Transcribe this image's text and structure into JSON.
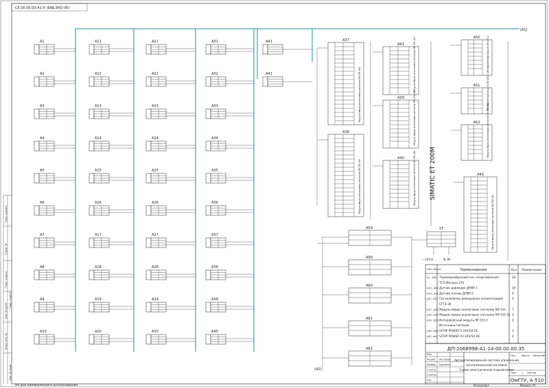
{
  "drawing": {
    "code": "ДП-2068998-А1-14-00.00.00.35",
    "title_lines": [
      "Автоматизированная система управления",
      "вентиляционной системой",
      "Схема электрическая подключения"
    ],
    "org": "ОмГТУ, А-510",
    "rotated_code": "СЕ.00.00.00-А1-У.-ВАБ.8КО-ЯО",
    "corner_refs": [
      "(А1)",
      "(А2)"
    ],
    "format_label": "Формат   А1",
    "copy_label": "Копировал",
    "sheet_labels": [
      "Лит.",
      "Масса",
      "Масштаб",
      "Лист",
      "Листов"
    ],
    "sheet_value": "1",
    "sign_rows": [
      "Изм.",
      "Разраб.",
      "Провер.",
      "Т.контр.",
      "Н.контр.",
      "Утв."
    ],
    "sign_names": [
      "Нестеров",
      "Бурменко"
    ]
  },
  "groups": [
    {
      "prefix": "A",
      "labels": [
        "A1",
        "A2",
        "A3",
        "A4",
        "A5",
        "A6",
        "A7",
        "A8",
        "A9",
        "A10"
      ]
    },
    {
      "prefix": "A1",
      "labels": [
        "A11",
        "A12",
        "A13",
        "A14",
        "A15",
        "A16",
        "A17",
        "A18",
        "A19",
        "A20"
      ]
    },
    {
      "prefix": "A2",
      "labels": [
        "A21",
        "A22",
        "A23",
        "A24",
        "A25",
        "A26",
        "A27",
        "A28",
        "A29",
        "A30"
      ]
    },
    {
      "prefix": "A3",
      "labels": [
        "A31",
        "A32",
        "A33",
        "A34",
        "A35",
        "A36",
        "A37",
        "A38",
        "A39",
        "A40"
      ]
    }
  ],
  "extra_sensors": [
    "A41",
    "A42"
  ],
  "io_modules": [
    {
      "label": "A37",
      "desc": "Модуль ввода аналоговых сигналов SM 331 8AI"
    },
    {
      "label": "A38",
      "desc": "Модуль ввода аналоговых сигналов SM 331 8AI"
    },
    {
      "label": "A41",
      "desc": "Модуль ввода аналоговых сигналов SM 331 8AI"
    },
    {
      "label": "A39",
      "desc": "Модуль ввода аналоговых сигналов SM 331 8AI"
    },
    {
      "label": "A40",
      "desc": "Модуль ввода аналоговых сигналов SM 331 8AI"
    },
    {
      "label": "A50",
      "desc": "Интерфейсный модуль IM 153-2"
    },
    {
      "label": "A51",
      "desc": "Интерфейсный модуль IM 153-2"
    },
    {
      "label": "A52",
      "desc": "Модуль ввода аналоговых сигналов SM 331 8AI"
    },
    {
      "label": "A43",
      "desc": "Модуль ввода аналоговых сигналов SM 331 8AI"
    }
  ],
  "simatic_label": "SIMATIC ET 200M",
  "power_units": [
    "A59",
    "A58",
    "A60",
    "A61",
    "A62"
  ],
  "xt_label": "XT",
  "xt_notes": [
    "~220 В",
    "N, PE"
  ],
  "spec": {
    "headers": [
      "Поз. обозн.",
      "Наименование",
      "Кол.",
      "Примечание"
    ],
    "rows": [
      {
        "pos": "A1...A24",
        "name": "Термопреобразователь сопротивления",
        "qty": "24"
      },
      {
        "pos": "",
        "name": "ТСП Метран-276",
        "qty": ""
      },
      {
        "pos": "A25...A34",
        "name": "Датчик давления ДПВР-1",
        "qty": "10"
      },
      {
        "pos": "A35...A38",
        "name": "Датчик потока ДПВР-2",
        "qty": "4"
      },
      {
        "pos": "A41, A42",
        "name": "Сигнализатор довзрывных концентраций",
        "qty": "2"
      },
      {
        "pos": "",
        "name": "СГГ4-30",
        "qty": ""
      },
      {
        "pos": "A37...A38",
        "name": "Модуль ввода аналоговых сигналов SM 331",
        "qty": "7"
      },
      {
        "pos": "A39...A41",
        "name": "Модуль ввода аналоговых сигналов SM 331 Ex",
        "qty": "5"
      },
      {
        "pos": "A50...A53",
        "name": "Интерфейсный модуль IM 153-2",
        "qty": "2"
      },
      {
        "pos": "",
        "name": "Источники питания",
        "qty": ""
      },
      {
        "pos": "A58...A60",
        "name": "SITOP POWER 5 24V/5A DC",
        "qty": "3"
      },
      {
        "pos": "A61, A62",
        "name": "SITOP POWER 10 24V/5A DC",
        "qty": "2"
      }
    ]
  },
  "left_margin": {
    "lines": [
      "Перв. примен.",
      "Справ. №",
      "Подп. и дата",
      "Инв. № дубл.",
      "Взам. инв. №",
      "Подп. и дата",
      "Инв. № подл."
    ],
    "note": "Не для коммерческого использования"
  }
}
